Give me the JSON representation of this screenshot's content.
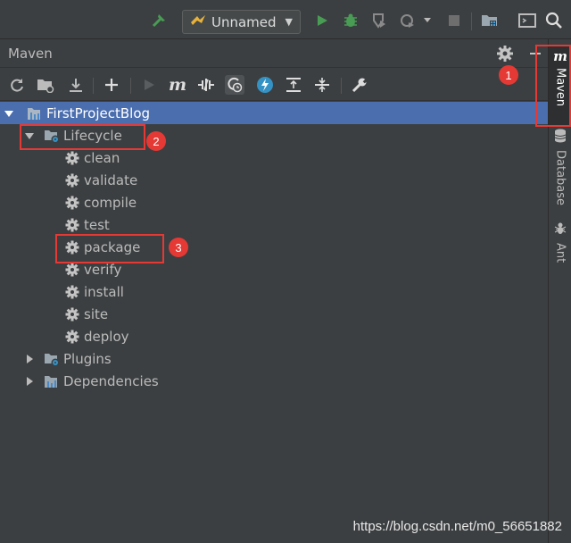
{
  "toolbar": {
    "run_config_label": "Unnamed",
    "icons": [
      "build-hammer-icon",
      "run-icon",
      "debug-icon",
      "coverage-icon",
      "profile-icon",
      "stop-icon",
      "project-structure-icon",
      "terminal-icon",
      "search-icon"
    ]
  },
  "maven": {
    "title": "Maven",
    "toolbar_icons": [
      "reload-icon",
      "generate-sources-icon",
      "download-icon",
      "add-icon",
      "run-maven-icon",
      "execute-goal-icon",
      "toggle-offline-icon",
      "skip-tests-icon",
      "show-dependencies-icon",
      "expand-all-icon",
      "collapse-all-icon",
      "settings-wrench-icon"
    ]
  },
  "tree": {
    "project": "FirstProjectBlog",
    "lifecycle": {
      "label": "Lifecycle",
      "goals": [
        "clean",
        "validate",
        "compile",
        "test",
        "package",
        "verify",
        "install",
        "site",
        "deploy"
      ]
    },
    "plugins": "Plugins",
    "dependencies": "Dependencies"
  },
  "right_bar": {
    "tabs": [
      {
        "label": "Maven",
        "icon": "m"
      },
      {
        "label": "Database"
      },
      {
        "label": "Ant"
      }
    ]
  },
  "annotations": [
    "1",
    "2",
    "3"
  ],
  "watermark": "https://blog.csdn.net/m0_56651882",
  "colors": {
    "selection": "#4b6eaf",
    "panel_bg": "#3c3f41",
    "annotation_red": "#e53935",
    "run_green": "#499c54"
  }
}
